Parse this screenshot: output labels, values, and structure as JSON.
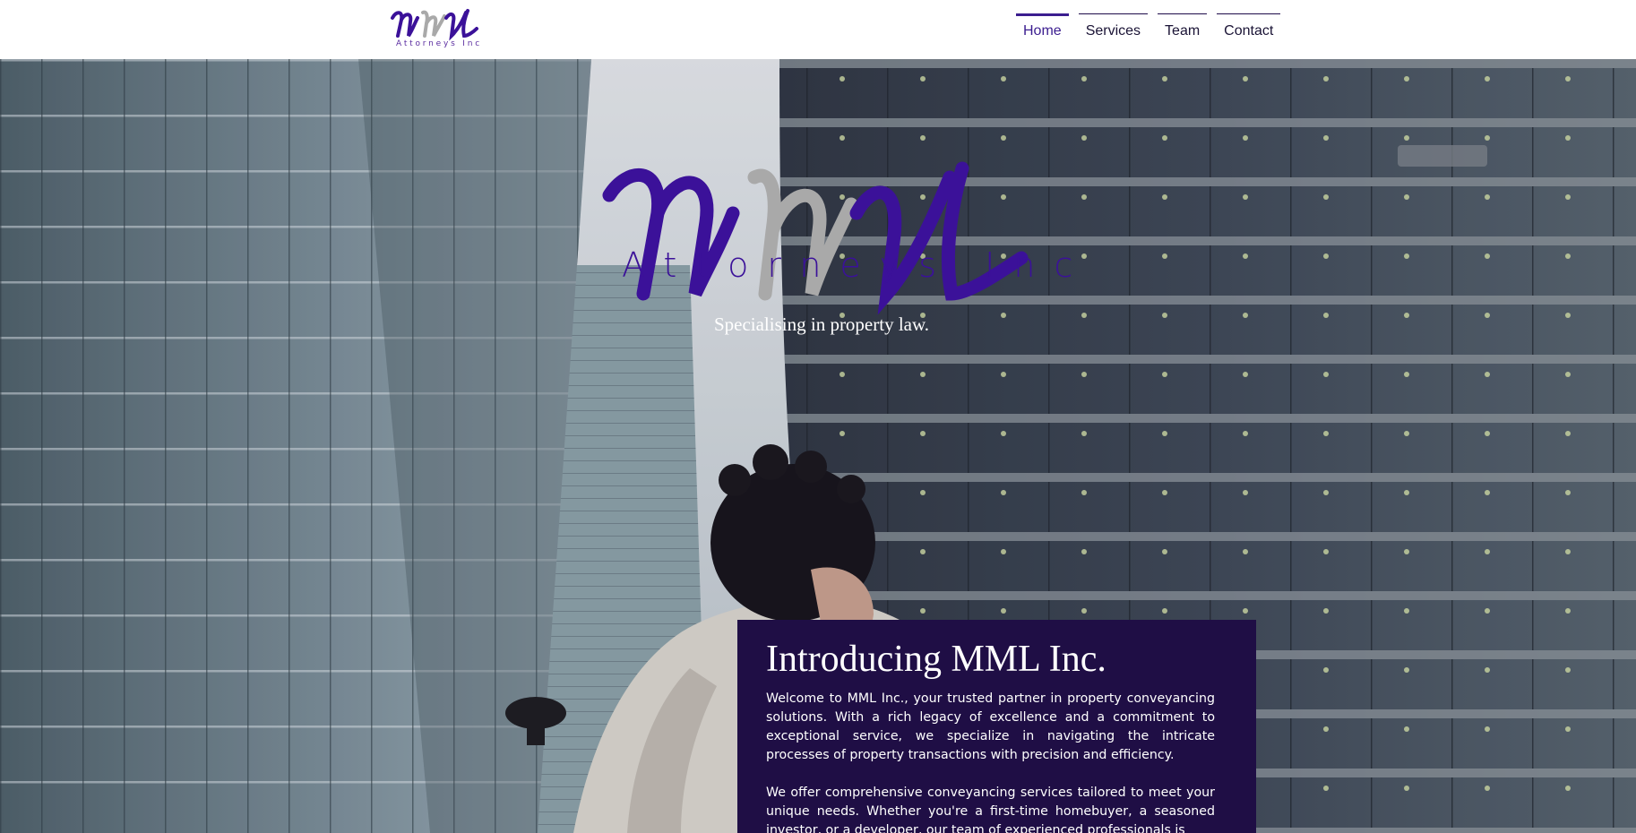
{
  "header": {
    "logo_subtitle": "Attorneys Inc",
    "nav": [
      {
        "label": "Home"
      },
      {
        "label": "Services"
      },
      {
        "label": "Team"
      },
      {
        "label": "Contact"
      }
    ]
  },
  "hero": {
    "logo_subtitle": "Attorneys Inc",
    "tagline": "Specialising in property law."
  },
  "intro": {
    "title": "Introducing MML Inc.",
    "paragraphs": [
      "Welcome to MML Inc., your trusted partner in property conveyancing solutions. With a rich legacy of excellence and a commitment to exceptional service, we specialize in navigating the intricate processes of property transactions with precision and efficiency.",
      "We offer comprehensive conveyancing services tailored to meet your unique needs. Whether you're a first-time homebuyer, a seasoned investor, or a developer, our team of experienced professionals is"
    ]
  },
  "colors": {
    "brand_purple": "#3b1199",
    "brand_grey": "#a9a9a9",
    "card_bg": "#1f0e45"
  }
}
